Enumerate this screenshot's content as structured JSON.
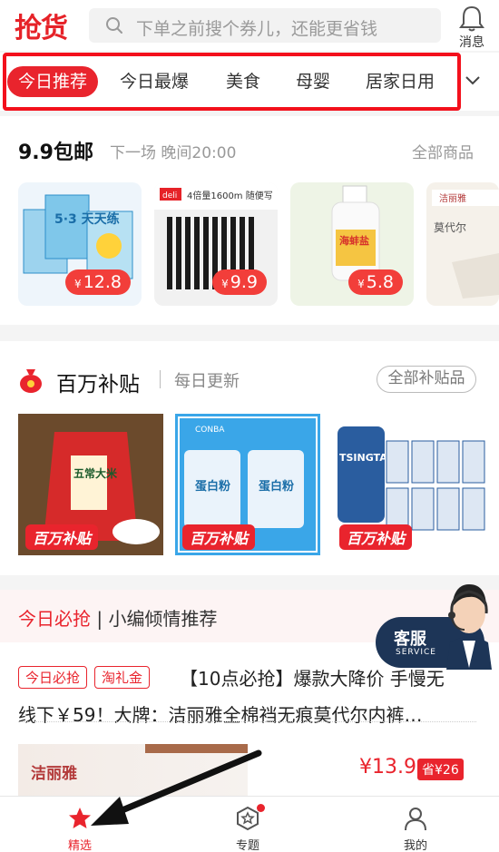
{
  "header": {
    "logo": "抢货",
    "search_placeholder": "下单之前搜个券儿，还能更省钱",
    "message_label": "消息"
  },
  "category_tabs": [
    "今日推荐",
    "今日最爆",
    "美食",
    "母婴",
    "居家日用"
  ],
  "flash_sale": {
    "title": "9.9包邮",
    "subtitle": "下一场 晚间20:00",
    "more": "全部商品",
    "items": [
      {
        "price": "12.8",
        "pack_text": "5·3 天天练"
      },
      {
        "price": "9.9",
        "brand": "deli",
        "pack_text": "4倍量1600m  随便写"
      },
      {
        "price": "5.8",
        "pack_text": "海蚌盐"
      },
      {
        "price": "",
        "brand": "洁丽雅",
        "pack_text": "莫代尔"
      }
    ],
    "currency": "¥"
  },
  "subsidy": {
    "title": "百万补贴",
    "subtitle": "每日更新",
    "more": "全部补贴品",
    "badge": "百万补贴",
    "items": [
      {
        "pack_text": "五常大米"
      },
      {
        "pack_text": "蛋白粉",
        "brand": "CONBA"
      },
      {
        "pack_text": "TSINGTAO"
      }
    ]
  },
  "today": {
    "title_red": "今日必抢",
    "title_rest": " | 小编倾情推荐",
    "tags": [
      "今日必抢",
      "淘礼金"
    ],
    "line1": "【10点必抢】爆款大降价 手慢无",
    "line2": "线下￥59！大牌：洁丽雅全棉裆无痕莫代尔内裤…",
    "brand": "洁丽雅",
    "price": "¥13.9",
    "save": "省¥26"
  },
  "customer_service": {
    "label": "客服",
    "sub": "SERVICE"
  },
  "tabbar": [
    {
      "label": "精选",
      "icon": "star-icon",
      "active": true
    },
    {
      "label": "专题",
      "icon": "topic-icon",
      "active": false
    },
    {
      "label": "我的",
      "icon": "user-icon",
      "active": false
    }
  ],
  "colors": {
    "brand_red": "#e9242d",
    "highlight_box": "#f3101c"
  }
}
